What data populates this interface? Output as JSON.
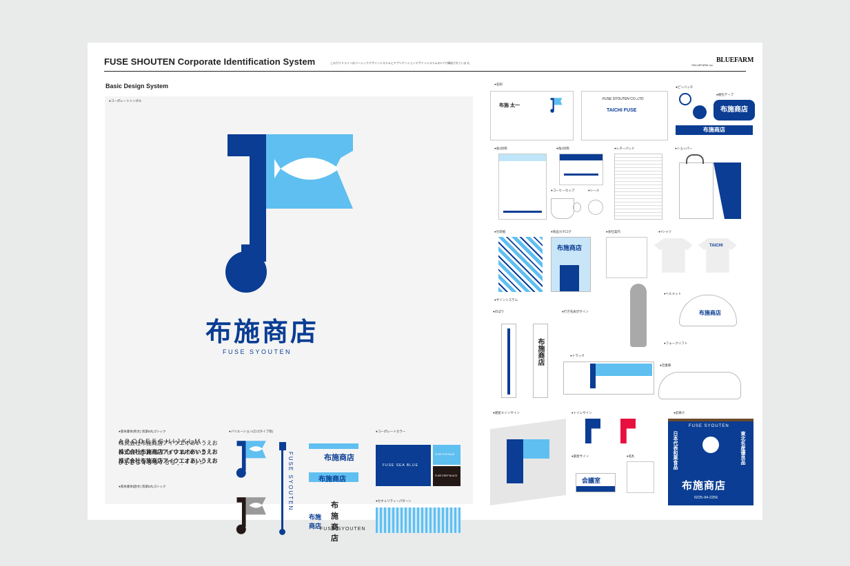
{
  "header": {
    "title": "FUSE SHOUTEN Corporate Identification System",
    "description": "このガイドラインはベーシックデザインシステムとアプリケーションデザインシステムの2つで構成されています。",
    "credit": "©BLUEFARM Inc.",
    "brand": "BLUEFARM"
  },
  "basic": {
    "section_title": "Basic Design System",
    "symbol_label": "●コーポレートシンボル",
    "company_name": "布施商店",
    "company_romaji": "FUSE SYOUTEN",
    "font_label_jp": "●基本書体(和文) 筑紫B丸ゴシック",
    "font_samples": [
      "株式会社布施商店アイウエオあいうえお",
      "株式会社布施商店アイウエオあいうえお",
      "株式会社布施商店アイウエオあいうえお"
    ],
    "font_label_en": "●基本書体(欧文) 筑紫B丸ゴシック",
    "alphabet": "ABCDEFGHIJKLM\nNOPQRSTUVWXYZ\n0123456789,.+-/=",
    "variation_label": "●バリエーション(ロゴタイプ等)",
    "variation_names": [
      "布施商店",
      "布施商店",
      "布施商店",
      "布施\n商店"
    ],
    "variation_romaji": "FUSE SYOUTEN",
    "color_label": "●コーポレートカラー",
    "color_main": "FUSE SEA BLUE",
    "color_sub1": "FUSE FISH BLUE",
    "color_sub2": "FUSE DEEP BLACK",
    "pattern_label": "●セキュリティーパターン",
    "colors": {
      "sea_blue": "#0a3d93",
      "fish_blue": "#5fbff0",
      "deep_black": "#231815"
    }
  },
  "apps": {
    "business_card_label": "●名刺",
    "card_name": "布施 太一",
    "card_company": "FUSE SYOUTEN CO.,LTD",
    "card_en_name": "TAICHI FUSE",
    "pins_label": "●ピンバッチ",
    "tape_label": "●梱包テープ",
    "tape_text": "布施商店",
    "envelope_label": "●長3封筒",
    "envelope2_label": "●角2封筒",
    "letter_label": "●レターパッド",
    "bag_label": "●ショッパー",
    "cup_label": "●コーヒーカップ",
    "seal_label": "●シール",
    "wrap_label": "●包装紙",
    "catalog_label": "●商品カタログ",
    "catalog_title": "布施商店",
    "brochure_label": "●会社案内",
    "shirt_label": "●Tシャツ",
    "shirt_text": "TAICHI",
    "helmet_label": "●ヘルメット",
    "helmet_text": "布施商店",
    "sign_label": "●サインシステム",
    "flag_label": "●のぼり",
    "guide_label": "●行き先表示サイン",
    "forklift_label": "●フォークリフト",
    "truck_label": "●トラック",
    "car_label": "●営業車",
    "main_sign_label": "●建屋メインサイン",
    "toilet_label": "●トイレサイン",
    "room_label": "●部屋サイン",
    "room_text": "会議室",
    "tag_label": "●名札",
    "banner_label": "●前掛け",
    "banner_top": "FUSE SYOUTEN",
    "banner_name": "布施商店",
    "banner_left": "日本代表和菓食品",
    "banner_right": "東北名産優良品",
    "banner_tel": "0225-94-2256"
  }
}
